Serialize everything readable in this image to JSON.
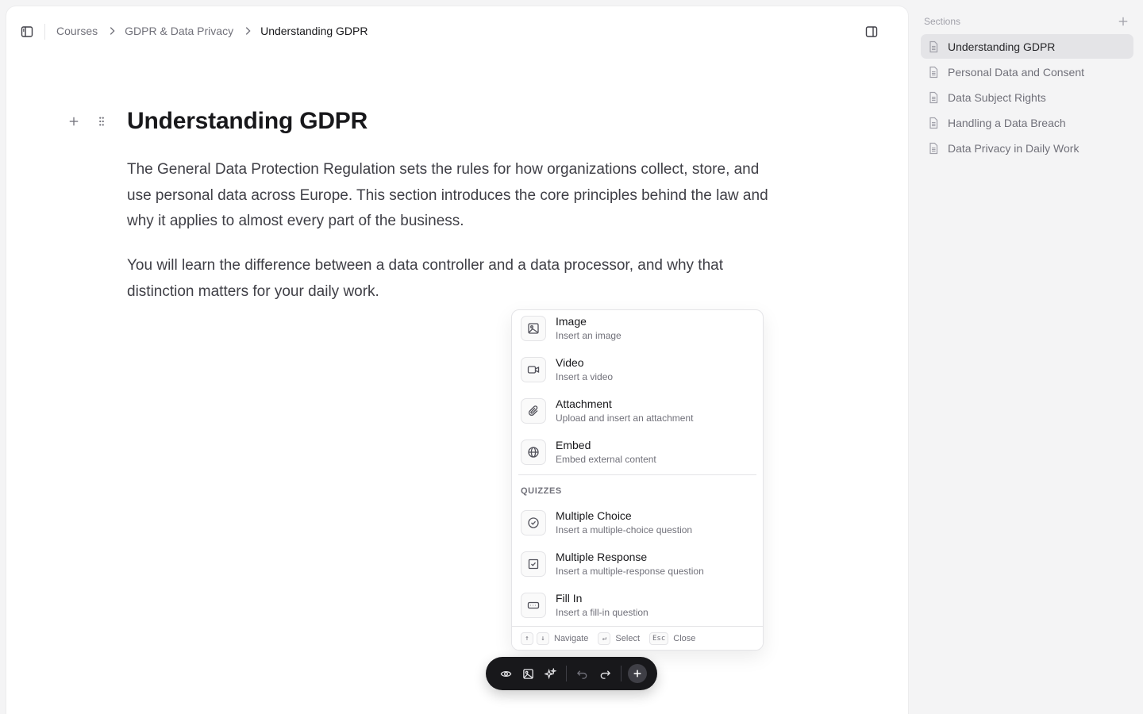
{
  "breadcrumb": {
    "items": [
      "Courses",
      "GDPR & Data Privacy"
    ],
    "current": "Understanding GDPR"
  },
  "document": {
    "title": "Understanding GDPR",
    "paragraphs": [
      "The General Data Protection Regulation sets the rules for how organizations collect, store, and use personal data across Europe. This section introduces the core principles behind the law and why it applies to almost every part of the business.",
      "You will learn the difference between a data controller and a data processor, and why that distinction matters for your daily work."
    ]
  },
  "insert_menu": {
    "items": [
      {
        "title": "Image",
        "description": "Insert an image",
        "icon": "image-icon"
      },
      {
        "title": "Video",
        "description": "Insert a video",
        "icon": "video-icon"
      },
      {
        "title": "Attachment",
        "description": "Upload and insert an attachment",
        "icon": "paperclip-icon"
      },
      {
        "title": "Embed",
        "description": "Embed external content",
        "icon": "globe-icon"
      }
    ],
    "quiz_group_label": "QUIZZES",
    "quiz_items": [
      {
        "title": "Multiple Choice",
        "description": "Insert a multiple-choice question",
        "icon": "circle-check-icon"
      },
      {
        "title": "Multiple Response",
        "description": "Insert a multiple-response question",
        "icon": "square-check-icon"
      },
      {
        "title": "Fill In",
        "description": "Insert a fill-in question",
        "icon": "text-input-icon"
      }
    ],
    "footer": {
      "navigate_keys": [
        "↑",
        "↓"
      ],
      "navigate_label": "Navigate",
      "select_key": "↵",
      "select_label": "Select",
      "close_key": "Esc",
      "close_label": "Close"
    }
  },
  "sidebar": {
    "header": "Sections",
    "items": [
      {
        "label": "Understanding GDPR",
        "active": true
      },
      {
        "label": "Personal Data and Consent",
        "active": false
      },
      {
        "label": "Data Subject Rights",
        "active": false
      },
      {
        "label": "Handling a Data Breach",
        "active": false
      },
      {
        "label": "Data Privacy in Daily Work",
        "active": false
      }
    ]
  },
  "colors": {
    "toolbar_bg": "#18181b",
    "active_section_bg": "#e4e4e7",
    "page_bg": "#f4f4f5"
  }
}
